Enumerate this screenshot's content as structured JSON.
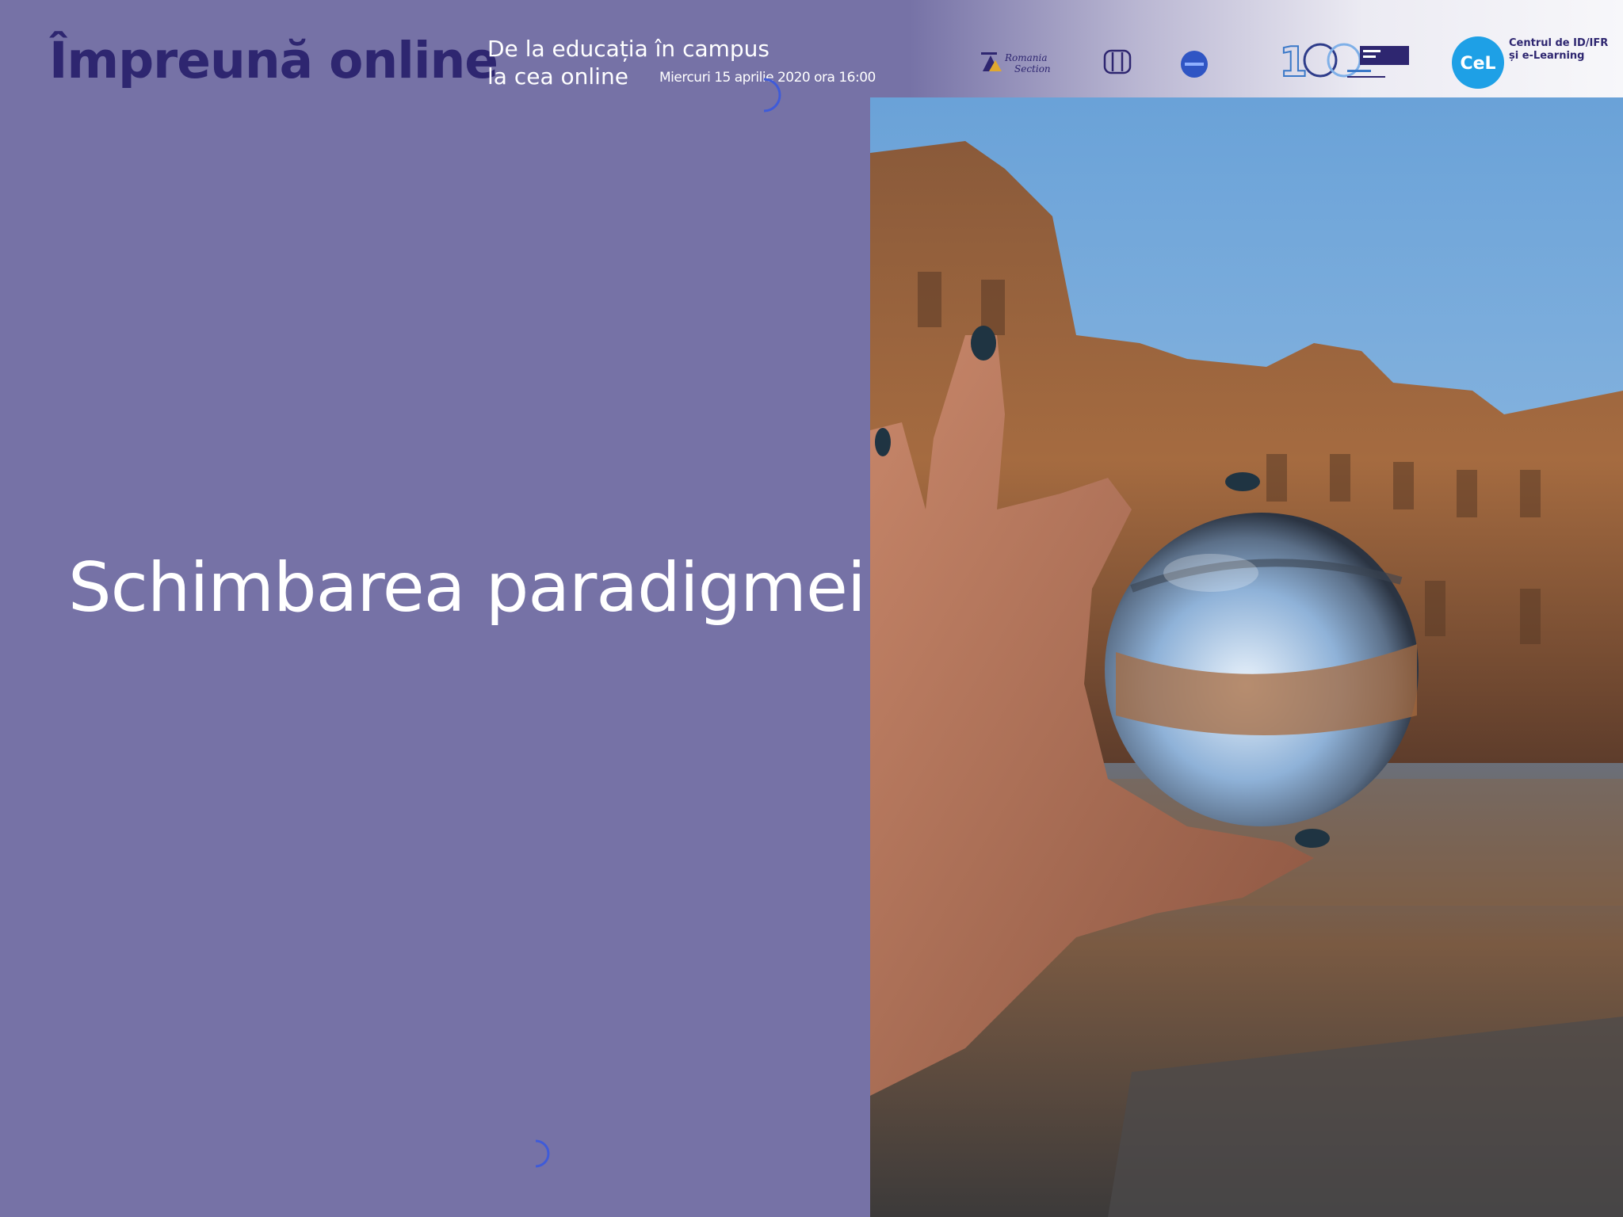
{
  "header": {
    "brand": "Împreună online",
    "event_line1": "De la educația în campus",
    "event_line2": "la cea online",
    "event_date": "Miercuri 15 aprilie 2020 ora 16:00",
    "partner_logos": [
      "ieee-romania-section-logo",
      "oxi-logo",
      "round-badge-logo",
      "100-years-upt-logo",
      "cel-logo"
    ],
    "cel_logo_text": "CeL",
    "cel_center_line1": "Centrul de ID/IFR",
    "cel_center_line2": "și e-Learning"
  },
  "slide": {
    "title": "Schimbarea paradigmei"
  },
  "photo": {
    "description_icon": "crystal-ball-photo"
  },
  "colors": {
    "panel_bg": "#7672a6",
    "brand_text": "#2e2670",
    "title_text": "#ffffff",
    "cel_circle": "#1ea0e6"
  }
}
